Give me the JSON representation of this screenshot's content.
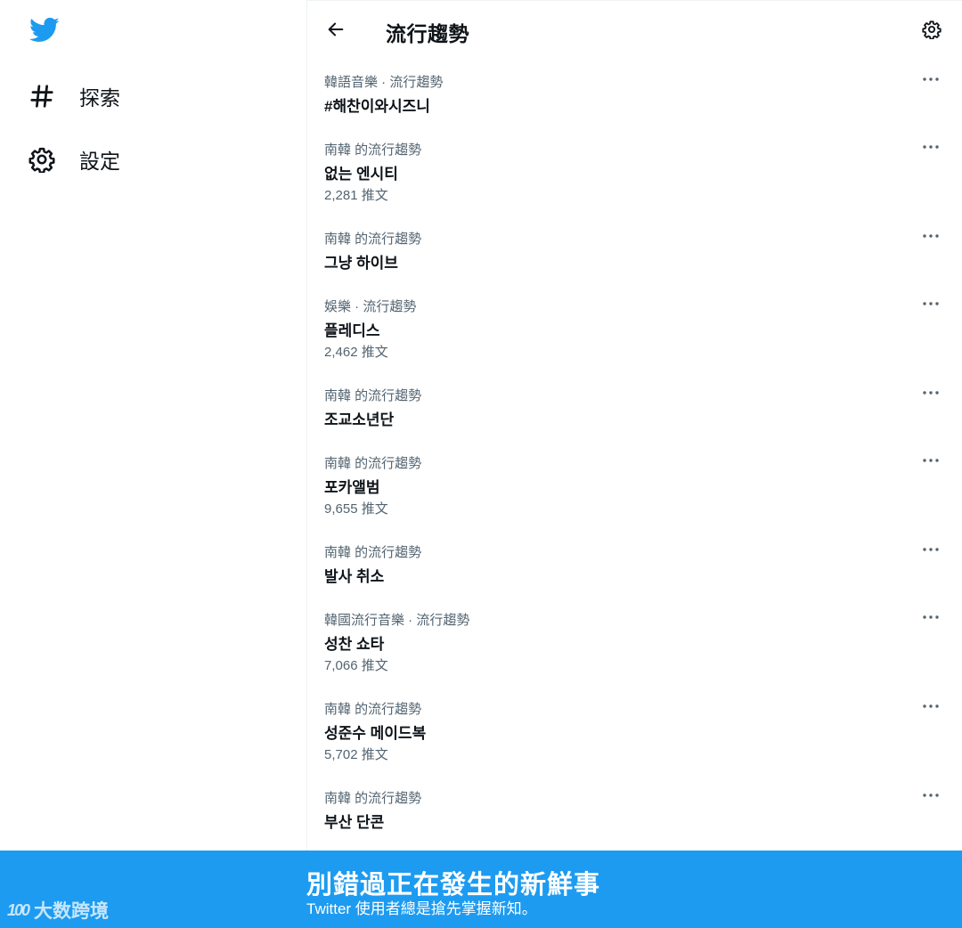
{
  "nav": {
    "items": [
      {
        "label": "探索",
        "icon": "hashtag-icon"
      },
      {
        "label": "設定",
        "icon": "gear-icon"
      }
    ]
  },
  "header": {
    "title": "流行趨勢"
  },
  "trends": [
    {
      "context": "韓語音樂 · 流行趨勢",
      "name": "#해찬이와시즈니",
      "count": ""
    },
    {
      "context": "南韓 的流行趨勢",
      "name": "없는 엔시티",
      "count": "2,281 推文"
    },
    {
      "context": "南韓 的流行趨勢",
      "name": "그냥 하이브",
      "count": ""
    },
    {
      "context": "娛樂 · 流行趨勢",
      "name": "플레디스",
      "count": "2,462 推文"
    },
    {
      "context": "南韓 的流行趨勢",
      "name": "조교소년단",
      "count": ""
    },
    {
      "context": "南韓 的流行趨勢",
      "name": "포카앨범",
      "count": "9,655 推文"
    },
    {
      "context": "南韓 的流行趨勢",
      "name": "발사 취소",
      "count": ""
    },
    {
      "context": "韓國流行音樂 · 流行趨勢",
      "name": "성찬 쇼타",
      "count": "7,066 推文"
    },
    {
      "context": "南韓 的流行趨勢",
      "name": "성준수 메이드복",
      "count": "5,702 推文"
    },
    {
      "context": "南韓 的流行趨勢",
      "name": "부산 단콘",
      "count": ""
    }
  ],
  "banner": {
    "title": "別錯過正在發生的新鮮事",
    "subtitle": "Twitter 使用者總是搶先掌握新知。"
  },
  "watermark": {
    "mark": "100",
    "text": "大数跨境"
  },
  "colors": {
    "accent": "#1d9bf0",
    "text": "#0f1419",
    "secondary": "#536471"
  }
}
